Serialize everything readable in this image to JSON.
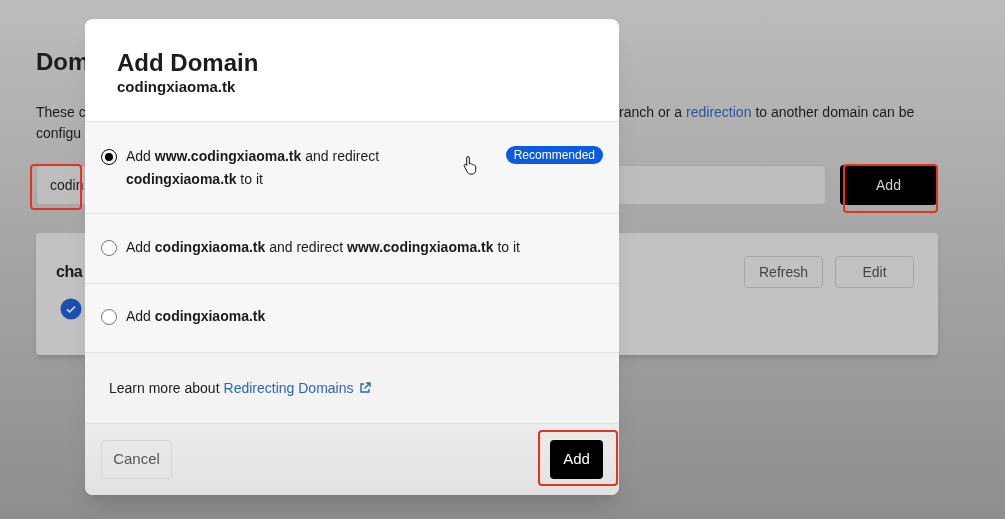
{
  "page": {
    "heading": "Dom",
    "description_line_1_left": "These c",
    "description_line_1_right": "ranch or a",
    "description_link": "redirection",
    "description_line_1_end": "to another domain can be",
    "description_line_2_left": "configu",
    "domain_field_value": "codin",
    "add_button": "Add",
    "card_title": "cha",
    "refresh_button": "Refresh",
    "edit_button": "Edit",
    "verified": true
  },
  "modal": {
    "title": "Add Domain",
    "subtitle": "codingxiaoma.tk",
    "options": [
      {
        "text": "Add **www.codingxiaoma.tk** and redirect **codingxiaoma.tk** to it",
        "selected": true,
        "badge": "Recommended"
      },
      {
        "text": "Add **codingxiaoma.tk** and redirect **www.codingxiaoma.tk** to it",
        "selected": false
      },
      {
        "text": "Add **codingxiaoma.tk**",
        "selected": false
      }
    ],
    "learn_more": {
      "text": "Learn more about",
      "link": "Redirecting Domains"
    },
    "cancel_button": "Cancel",
    "add_button": "Add"
  }
}
